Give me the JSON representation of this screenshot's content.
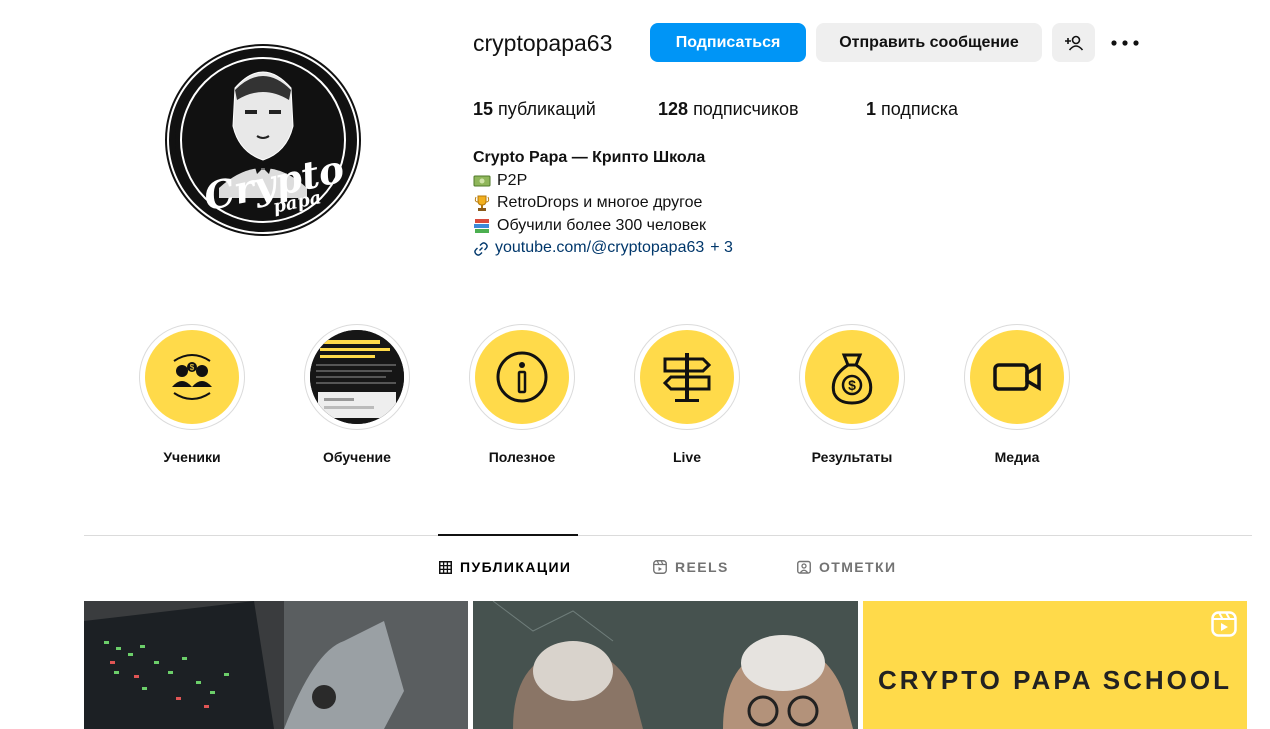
{
  "profile": {
    "username": "cryptopapa63",
    "avatar_text_main": "Crypto",
    "avatar_text_sub": "papa"
  },
  "actions": {
    "follow_label": "Подписаться",
    "message_label": "Отправить сообщение",
    "add_user_icon": "add-user-icon",
    "more_icon": "more-icon"
  },
  "stats": {
    "posts_count": "15",
    "posts_label": "публикаций",
    "followers_count": "128",
    "followers_label": "подписчиков",
    "following_count": "1",
    "following_label": "подписка"
  },
  "bio": {
    "name": "Crypto Papa — Крипто Школа",
    "lines": [
      {
        "icon": "money-icon",
        "text": "P2P"
      },
      {
        "icon": "trophy-icon",
        "text": "RetroDrops и многое другое"
      },
      {
        "icon": "books-icon",
        "text": "Обучили более 300 человек"
      }
    ],
    "link_text": "youtube.com/@cryptopapa63",
    "link_more": "+ 3"
  },
  "highlights": [
    {
      "label": "Ученики",
      "icon": "people-exchange-icon"
    },
    {
      "label": "Обучение",
      "icon": "lesson-screenshot"
    },
    {
      "label": "Полезное",
      "icon": "info-icon"
    },
    {
      "label": "Live",
      "icon": "signpost-icon"
    },
    {
      "label": "Результаты",
      "icon": "money-bag-icon"
    },
    {
      "label": "Медиа",
      "icon": "video-camera-icon"
    }
  ],
  "tabs": [
    {
      "label": "ПУБЛИКАЦИИ",
      "icon": "grid-icon",
      "active": true
    },
    {
      "label": "REELS",
      "icon": "reels-icon",
      "active": false
    },
    {
      "label": "ОТМЕТКИ",
      "icon": "tagged-icon",
      "active": false
    }
  ],
  "posts": [
    {
      "kind": "image",
      "description_icon": "trading-screen-image"
    },
    {
      "kind": "image",
      "description_icon": "old-men-image"
    },
    {
      "kind": "reel",
      "title": "CRYPTO PAPA SCHOOL",
      "icon": "reels-icon"
    }
  ],
  "colors": {
    "accent": "#0095f6",
    "highlight_fill": "#ffda4a",
    "link": "#00376b",
    "muted": "#737373"
  }
}
